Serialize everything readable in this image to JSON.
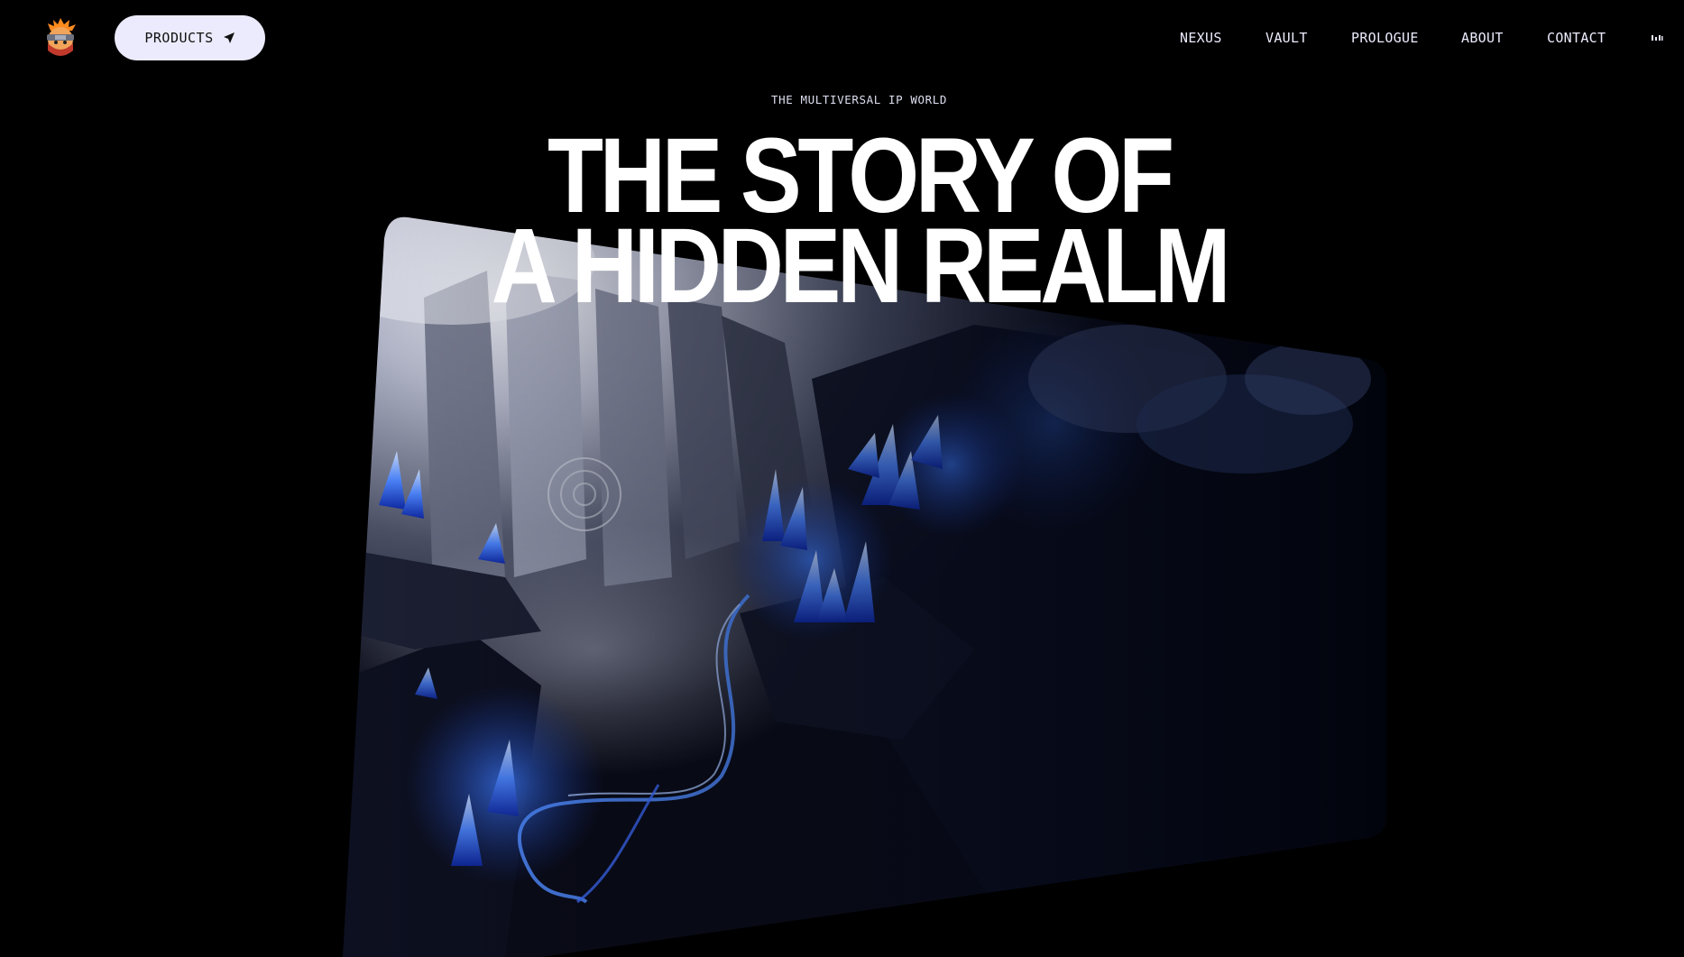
{
  "header": {
    "logo_alt": "ninja mascot logo",
    "products_label": "PRODUCTS",
    "nav": [
      {
        "label": "NEXUS"
      },
      {
        "label": "VAULT"
      },
      {
        "label": "PROLOGUE"
      },
      {
        "label": "ABOUT"
      },
      {
        "label": "CONTACT"
      }
    ],
    "audio_icon": "sound-bars-icon"
  },
  "hero": {
    "eyebrow": "THE MULTIVERSAL IP WORLD",
    "title_line1": "THE STORY OF",
    "title_line2": "A HIDDEN REALM",
    "scene": "crystal-cavern-artwork"
  },
  "colors": {
    "background": "#000000",
    "button_bg": "#ecebfd",
    "nav_text": "#ecebfd",
    "crystal_blue": "#2f6bff"
  }
}
